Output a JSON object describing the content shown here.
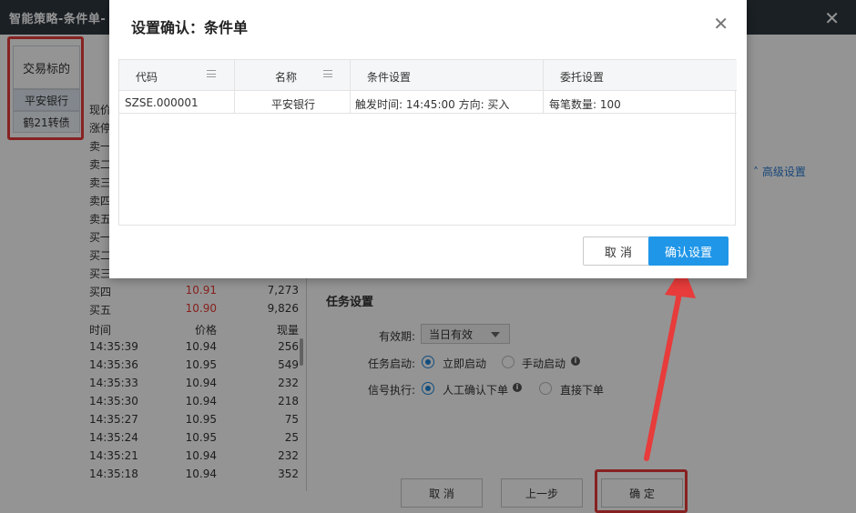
{
  "window": {
    "title": "智能策略-条件单-",
    "close": "✕"
  },
  "sidebar": {
    "header": "交易标的",
    "items": [
      "平安银行",
      "鹤21转债"
    ]
  },
  "quotes": {
    "rows": [
      {
        "label": "现价",
        "price": "",
        "vol": ""
      },
      {
        "label": "涨停",
        "price": "",
        "vol": ""
      },
      {
        "label": "卖一",
        "price": "",
        "vol": ""
      },
      {
        "label": "卖二",
        "price": "",
        "vol": ""
      },
      {
        "label": "卖三",
        "price": "",
        "vol": ""
      },
      {
        "label": "卖四",
        "price": "",
        "vol": ""
      },
      {
        "label": "卖五",
        "price": "",
        "vol": ""
      },
      {
        "label": "买一",
        "price": "",
        "vol": ""
      },
      {
        "label": "买二",
        "price": "",
        "vol": ""
      },
      {
        "label": "买三",
        "price": "",
        "vol": ""
      },
      {
        "label": "买四",
        "price": "10.91",
        "vol": "7,273"
      },
      {
        "label": "买五",
        "price": "10.90",
        "vol": "9,826"
      }
    ],
    "ticks_header": {
      "time": "时间",
      "price": "价格",
      "vol": "现量"
    },
    "ticks": [
      {
        "time": "14:35:39",
        "price": "10.94",
        "vol": "256"
      },
      {
        "time": "14:35:36",
        "price": "10.95",
        "vol": "549"
      },
      {
        "time": "14:35:33",
        "price": "10.94",
        "vol": "232"
      },
      {
        "time": "14:35:30",
        "price": "10.94",
        "vol": "218"
      },
      {
        "time": "14:35:27",
        "price": "10.95",
        "vol": "75"
      },
      {
        "time": "14:35:24",
        "price": "10.95",
        "vol": "25"
      },
      {
        "time": "14:35:21",
        "price": "10.94",
        "vol": "232"
      },
      {
        "time": "14:35:18",
        "price": "10.94",
        "vol": "352"
      }
    ]
  },
  "advanced": {
    "label": "高级设置",
    "icon": "chevron-up-icon"
  },
  "task": {
    "title": "任务设置",
    "validity_label": "有效期:",
    "validity_value": "当日有效",
    "start_label": "任务启动:",
    "start_opt1": "立即启动",
    "start_opt2": "手动启动",
    "signal_label": "信号执行:",
    "signal_opt1": "人工确认下单",
    "signal_opt2": "直接下单"
  },
  "bottom": {
    "cancel": "取 消",
    "prev": "上一步",
    "ok": "确 定"
  },
  "modal": {
    "title": "设置确认：条件单",
    "close": "✕",
    "columns": [
      "代码",
      "名称",
      "条件设置",
      "委托设置"
    ],
    "rows": [
      {
        "code": "SZSE.000001",
        "name": "平安银行",
        "condition": "触发时间: 14:45:00 方向: 买入",
        "order": "每笔数量: 100"
      }
    ],
    "cancel": "取 消",
    "confirm": "确认设置"
  },
  "colors": {
    "accent": "#1f96e8",
    "highlight": "#e83b3b",
    "titlebar": "#303841",
    "down_red": "#e53935"
  }
}
